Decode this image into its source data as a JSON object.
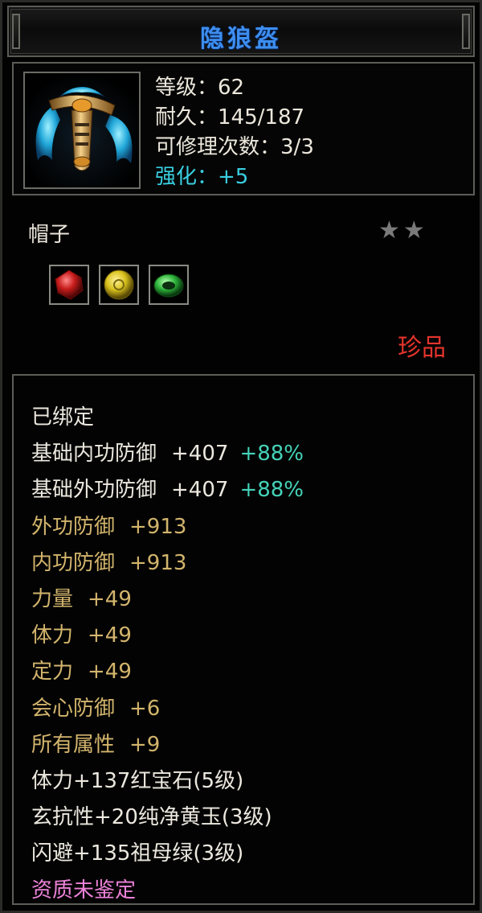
{
  "title": "隐狼盔",
  "stats": [
    {
      "label": "等级：",
      "value": "62"
    },
    {
      "label": "耐久：",
      "value": "145/187"
    },
    {
      "label": "可修理次数：",
      "value": "3/3"
    },
    {
      "label": "强化：",
      "value": "+5"
    }
  ],
  "item_type": "帽子",
  "stars": "★★",
  "star_count": 2,
  "gems": [
    {
      "name": "ruby-gem-icon",
      "color": "#c81c1c"
    },
    {
      "name": "yellow-jade-gem-icon",
      "color": "#d9c11c"
    },
    {
      "name": "emerald-gem-icon",
      "color": "#2db33a"
    }
  ],
  "rarity": "珍品",
  "bound": "已绑定",
  "base_attrs": [
    {
      "label": "基础内功防御",
      "value": "+407",
      "bonus": "+88%"
    },
    {
      "label": "基础外功防御",
      "value": "+407",
      "bonus": "+88%"
    }
  ],
  "attrs": [
    {
      "label": "外功防御",
      "value": "+913"
    },
    {
      "label": "内功防御",
      "value": "+913"
    },
    {
      "label": "力量",
      "value": "+49"
    },
    {
      "label": "体力",
      "value": "+49"
    },
    {
      "label": "定力",
      "value": "+49"
    },
    {
      "label": "会心防御",
      "value": "+6"
    },
    {
      "label": "所有属性",
      "value": "+9"
    }
  ],
  "gem_attrs": [
    "体力+137红宝石(5级)",
    "玄抗性+20纯净黄玉(3级)",
    "闪避+135祖母绿(3级)"
  ],
  "quality": "资质未鉴定",
  "colors": {
    "title": "#3d8ef0",
    "enhance": "#39cfe0",
    "bonus": "#45d2b8",
    "attr": "#d2b46c",
    "rarity": "#e4342c",
    "quality": "#ec82d8"
  }
}
